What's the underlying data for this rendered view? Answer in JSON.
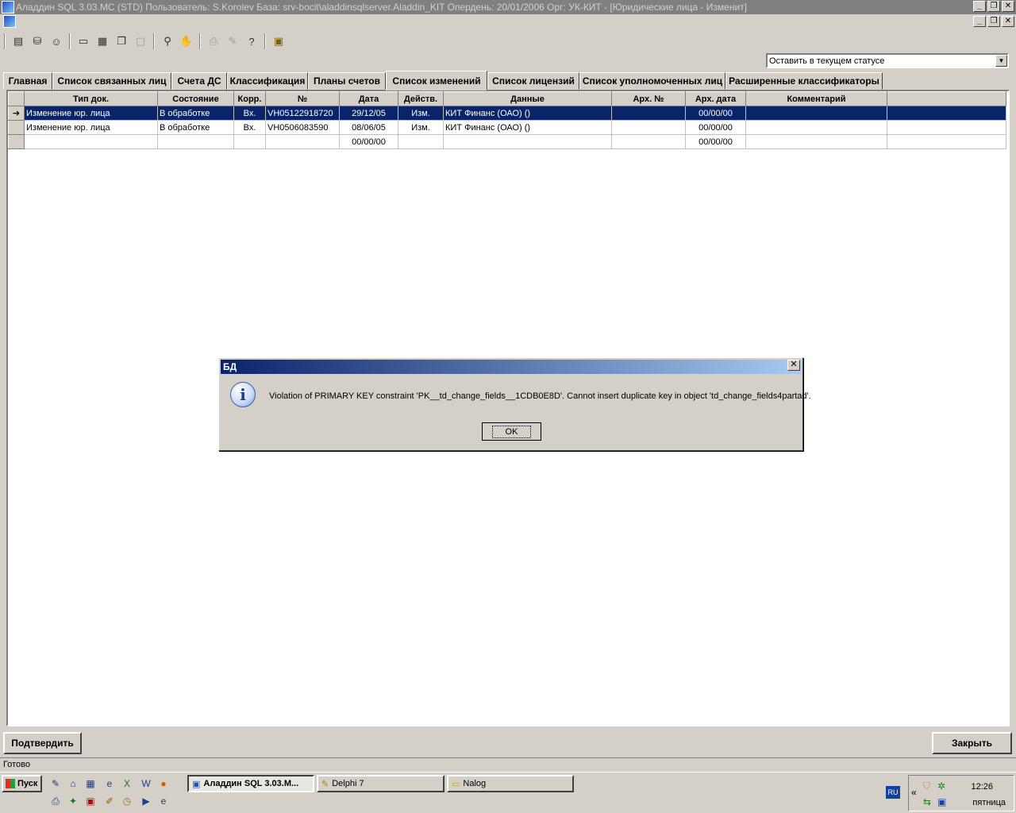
{
  "window": {
    "title": "Аладдин SQL 3.03.MC (STD)  Пользователь: S.Korolev База: srv-bocit\\aladdinsqlserver.Aladdin_KIT Опердень: 20/01/2006 Орг: УК-КИТ - [Юридические лица - Изменит]"
  },
  "status_select": {
    "value": "Оставить в текущем статусе"
  },
  "tabs": [
    "Главная",
    "Список связанных лиц",
    "Счета ДС",
    "Классификация",
    "Планы счетов",
    "Список изменений",
    "Список лицензий",
    "Список уполномоченных лиц",
    "Расширенные классификаторы"
  ],
  "grid": {
    "columns": [
      "Тип док.",
      "Состояние",
      "Корр.",
      "№",
      "Дата",
      "Действ.",
      "Данные",
      "Арх. №",
      "Арх. дата",
      "Комментарий"
    ],
    "rows": [
      [
        "Изменение юр. лица",
        "В обработке",
        "Вх.",
        "VH05122918720",
        "29/12/05",
        "Изм.",
        "КИТ Финанс (ОАО) ()",
        "",
        "00/00/00",
        ""
      ],
      [
        "Изменение юр. лица",
        "В обработке",
        "Вх.",
        "VH0506083590",
        "08/06/05",
        "Изм.",
        "КИТ Финанс (ОАО)  ()",
        "",
        "00/00/00",
        ""
      ],
      [
        "",
        "",
        "",
        "",
        "00/00/00",
        "",
        "",
        "",
        "00/00/00",
        ""
      ]
    ]
  },
  "dialog": {
    "title": "БД",
    "message": "Violation of PRIMARY KEY constraint 'PK__td_change_fields__1CDB0E8D'. Cannot insert duplicate key in object 'td_change_fields4partad'.",
    "ok_label": "OK"
  },
  "buttons": {
    "confirm": "Подтвердить",
    "close": "Закрыть"
  },
  "statusbar": {
    "text": "Готово"
  },
  "taskbar": {
    "start": "Пуск",
    "tasks": [
      "Аладдин SQL 3.03.M...",
      "Delphi 7",
      "Nalog"
    ],
    "lang": "RU",
    "time": "12:26",
    "day": "пятница"
  },
  "colors": {
    "selection": "#0a246a",
    "face": "#d4d0c8"
  }
}
